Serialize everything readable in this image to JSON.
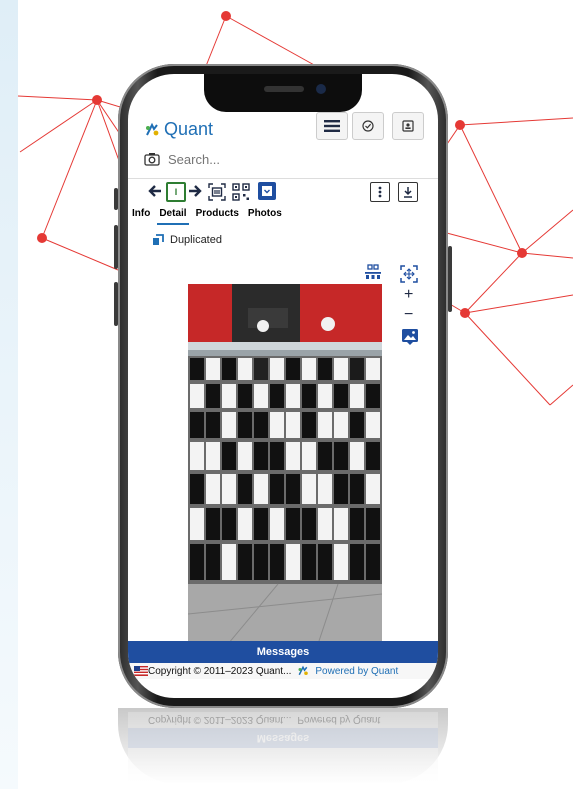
{
  "app": {
    "brand": "Quant"
  },
  "search": {
    "placeholder": "Search..."
  },
  "toolbar": {
    "frame_label": "I"
  },
  "tabs": [
    {
      "label": "Info"
    },
    {
      "label": "Detail"
    },
    {
      "label": "Products"
    },
    {
      "label": "Photos"
    }
  ],
  "active_tab": "Detail",
  "status": {
    "label": "Duplicated"
  },
  "zoom": {
    "plus": "+",
    "minus": "−"
  },
  "footer": {
    "messages": "Messages",
    "copyright": "Copyright © 2011–2023 Quant...",
    "powered": "Powered by Quant"
  },
  "colors": {
    "accent": "#1f6fb5",
    "messages_bar": "#1f4ea0",
    "toolbar_green": "#2e7d32",
    "network_red": "#e53935"
  },
  "icons": [
    "logo-icon",
    "hamburger-icon",
    "check-circle-icon",
    "contact-card-icon",
    "camera-icon",
    "arrow-left-icon",
    "arrow-right-icon",
    "barcode-scan-icon",
    "qr-scan-icon",
    "dropdown-box-icon",
    "more-vertical-icon",
    "download-icon",
    "duplicate-icon",
    "layout-icon",
    "fit-screen-icon",
    "image-edit-icon",
    "flag-icon"
  ]
}
